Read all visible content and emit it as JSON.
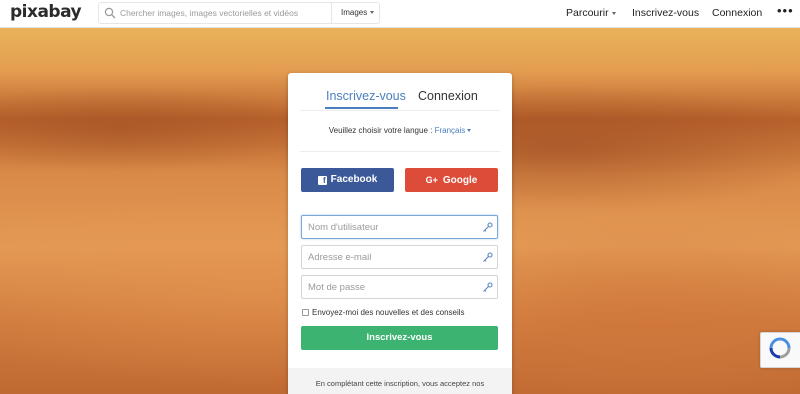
{
  "header": {
    "logo": "pixabay",
    "search": {
      "placeholder": "Chercher images, images vectorielles et vidéos",
      "type_label": "Images"
    },
    "nav": {
      "browse": "Parcourir",
      "signup": "Inscrivez-vous",
      "login": "Connexion",
      "more": "•••"
    }
  },
  "card": {
    "tabs": {
      "signup": "Inscrivez-vous",
      "login": "Connexion"
    },
    "language": {
      "prompt": "Veuillez choisir votre langue :",
      "value": "Français"
    },
    "social": {
      "facebook": "Facebook",
      "google": "Google"
    },
    "fields": {
      "username_placeholder": "Nom d'utilisateur",
      "email_placeholder": "Adresse e-mail",
      "password_placeholder": "Mot de passe"
    },
    "newsletter_label": "Envoyez-moi des nouvelles et des conseils",
    "submit_label": "Inscrivez-vous",
    "terms_text": "En complétant cette inscription, vous acceptez nos"
  },
  "colors": {
    "accent": "#4a7fbf",
    "facebook": "#3b5998",
    "google": "#dd4b39",
    "submit": "#3cb371"
  },
  "icons": {
    "search": "search-icon",
    "field": "key-icon",
    "facebook": "facebook-icon",
    "google": "google-plus-icon",
    "recaptcha": "recaptcha-icon"
  }
}
